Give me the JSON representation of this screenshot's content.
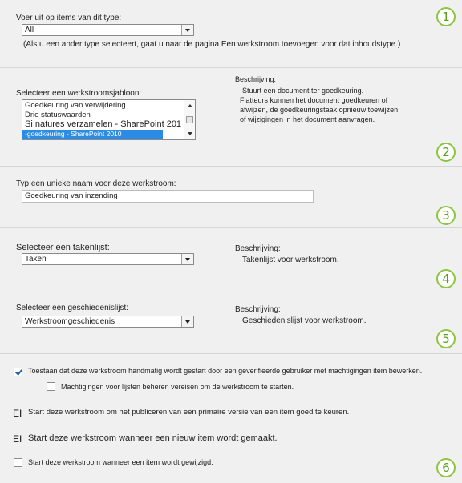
{
  "section1": {
    "label": "Voer uit op items van dit type:",
    "select_value": "All",
    "note": "(Als u een ander type selecteert, gaat u naar de pagina Een werkstroom toevoegen voor dat inhoudstype.)",
    "badge": "1"
  },
  "section2": {
    "label": "Selecteer een werkstroomsjabloon:",
    "templates": [
      "Goedkeuring van verwijdering",
      "Drie statuswaarden",
      "Si natures verzamelen - SharePoint 201",
      "-goedkeuring - SharePoint 2010"
    ],
    "desc_label": "Beschrijving:",
    "desc_lines": [
      "Stuurt een document ter goedkeuring.",
      "Fiatteurs kunnen het document goedkeuren of",
      "afwijzen, de goedkeuringstaak opnieuw toewijzen",
      "of wijzigingen in het document aanvragen."
    ],
    "badge": "2"
  },
  "section3": {
    "label": "Typ een unieke naam voor deze werkstroom:",
    "name_value": "Goedkeuring van inzending",
    "badge": "3"
  },
  "section4": {
    "label": "Selecteer een takenlijst:",
    "select_value": "Taken",
    "desc_label": "Beschrijving:",
    "desc_text": "Takenlijst voor werkstroom.",
    "badge": "4"
  },
  "section5": {
    "label": "Selecteer een geschiedenislijst:",
    "select_value": "Werkstroomgeschiedenis",
    "desc_label": "Beschrijving:",
    "desc_text": "Geschiedenislijst voor werkstroom.",
    "badge": "5"
  },
  "section6": {
    "opt_manual": "Toestaan dat deze werkstroom handmatig wordt gestart door een geverifieerde gebruiker met machtigingen item bewerken.",
    "opt_manual_checked": true,
    "opt_permissions": "Machtigingen voor lijsten beheren vereisen om de werkstroom te starten.",
    "opt_permissions_checked": false,
    "el_mark": "EI",
    "opt_publish": "Start deze werkstroom om het publiceren van een primaire versie van een item goed te keuren.",
    "opt_new_item": "Start deze werkstroom wanneer een nieuw item wordt gemaakt.",
    "opt_changed": "Start deze werkstroom wanneer een item wordt gewijzigd.",
    "opt_changed_checked": false,
    "badge": "6"
  }
}
